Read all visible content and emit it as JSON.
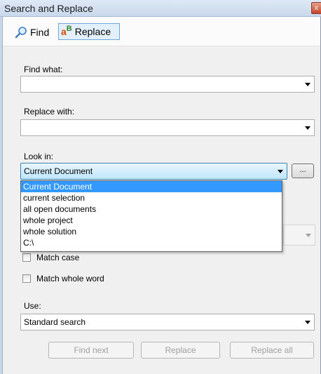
{
  "window": {
    "title": "Search and Replace",
    "close_glyph": "x"
  },
  "toolbar": {
    "find": {
      "label": "Find",
      "icon": "search-icon"
    },
    "replace": {
      "label": "Replace",
      "icon": "replace-icon",
      "icon_text_a": "a",
      "icon_text_b": "B"
    }
  },
  "find_what": {
    "label": "Find what:",
    "value": ""
  },
  "replace_with": {
    "label": "Replace with:",
    "value": ""
  },
  "look_in": {
    "label": "Look in:",
    "value": "Current Document",
    "browse_label": "...",
    "options": [
      "Current Document",
      "current selection",
      "all open documents",
      "whole project",
      "whole solution",
      "C:\\"
    ],
    "selected_index": 0
  },
  "options": {
    "match_case": {
      "label": "Match case",
      "checked": false
    },
    "match_whole_word": {
      "label": "Match whole word",
      "checked": false
    }
  },
  "use": {
    "label": "Use:",
    "value": "Standard search"
  },
  "buttons": {
    "find_next": "Find next",
    "replace": "Replace",
    "replace_all": "Replace all"
  },
  "colors": {
    "selection": "#3399ff",
    "accent_border": "#6fa7db"
  }
}
